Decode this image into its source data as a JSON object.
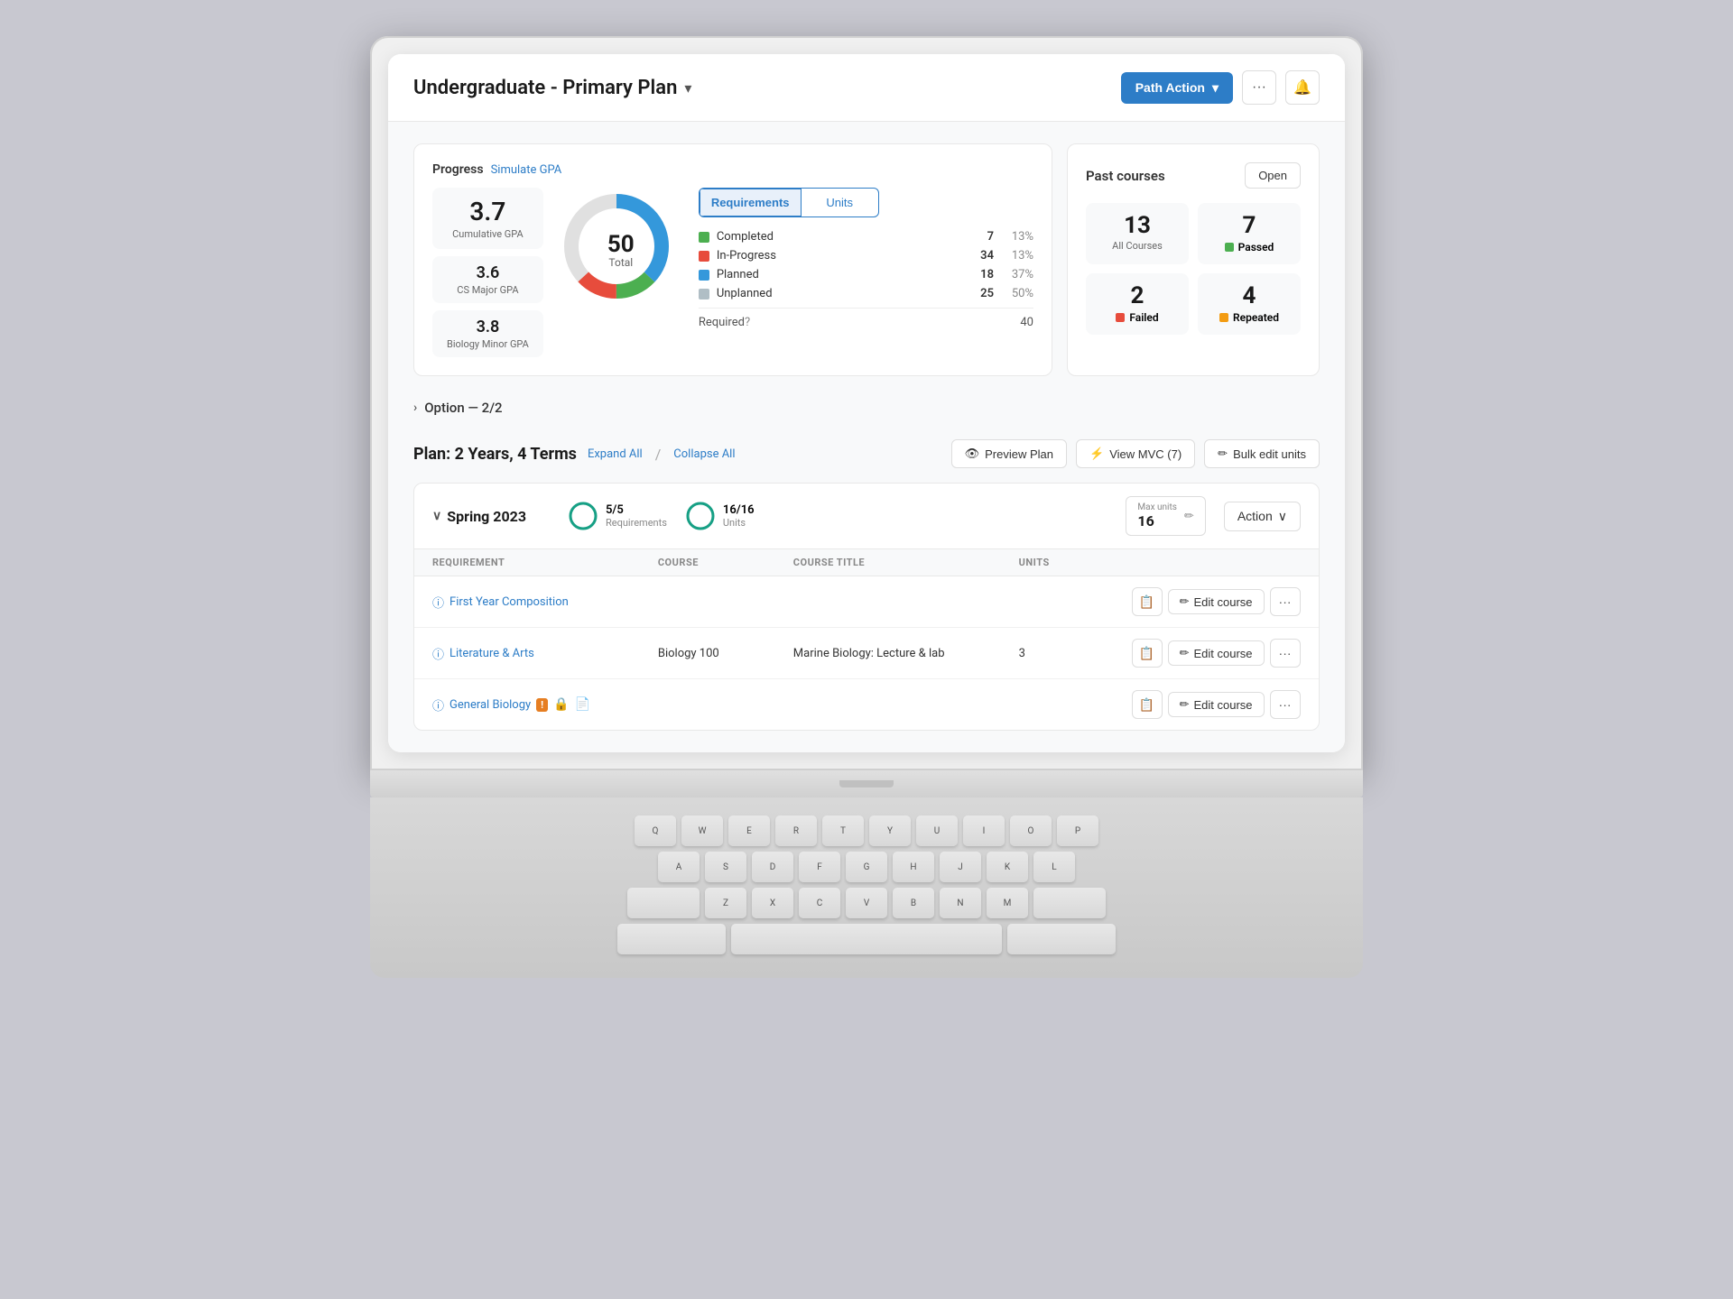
{
  "header": {
    "title": "Undergraduate - Primary Plan",
    "dropdown_icon": "▾",
    "path_action_label": "Path Action",
    "path_action_arrow": "▾",
    "more_icon": "•••",
    "bell_icon": "🔔"
  },
  "progress": {
    "label": "Progress",
    "simulate_gpa": "Simulate GPA",
    "cumulative_gpa": "3.7",
    "cumulative_gpa_label": "Cumulative GPA",
    "cs_major_gpa": "3.6",
    "cs_major_gpa_label": "CS Major GPA",
    "biology_minor_gpa": "3.8",
    "biology_minor_gpa_label": "Biology Minor GPA",
    "donut_total": "50",
    "donut_total_label": "Total",
    "tabs": {
      "requirements": "Requirements",
      "units": "Units"
    },
    "legend": [
      {
        "label": "Completed",
        "count": "7",
        "pct": "13%",
        "color": "#4caf50"
      },
      {
        "label": "In-Progress",
        "count": "34",
        "pct": "13%",
        "color": "#e74c3c"
      },
      {
        "label": "Planned",
        "count": "18",
        "pct": "37%",
        "color": "#3498db"
      },
      {
        "label": "Unplanned",
        "count": "25",
        "pct": "50%",
        "color": "#b0bec5"
      }
    ],
    "required_label": "Required",
    "required_value": "40"
  },
  "past_courses": {
    "title": "Past courses",
    "open_btn": "Open",
    "all_courses_count": "13",
    "all_courses_label": "All Courses",
    "passed_count": "7",
    "passed_label": "Passed",
    "passed_color": "#4caf50",
    "failed_count": "2",
    "failed_label": "Failed",
    "failed_color": "#e74c3c",
    "repeated_count": "4",
    "repeated_label": "Repeated",
    "repeated_color": "#f39c12"
  },
  "option_row": {
    "label": "Option — 2/2"
  },
  "plan": {
    "heading": "Plan: 2 Years, 4 Terms",
    "expand_all": "Expand All",
    "slash": "/",
    "collapse_all": "Collapse All",
    "preview_plan_icon": "👁",
    "preview_plan_label": "Preview Plan",
    "view_mvc_label": "View MVC (7)",
    "bulk_edit_label": "Bulk edit units"
  },
  "term": {
    "chevron": "∨",
    "name": "Spring 2023",
    "req_fraction": "5/5",
    "req_label": "Requirements",
    "units_fraction": "16/16",
    "units_label": "Units",
    "max_units_label": "Max units",
    "max_units_value": "16",
    "action_label": "Action",
    "action_chevron": "∨"
  },
  "table": {
    "columns": [
      "REQUIREMENT",
      "COURSE",
      "COURSE TITLE",
      "UNITS",
      ""
    ],
    "rows": [
      {
        "requirement": "First Year Composition",
        "course": "",
        "title": "",
        "units": "",
        "has_warning": false,
        "has_lock": false,
        "has_doc": false
      },
      {
        "requirement": "Literature & Arts",
        "course": "Biology 100",
        "title": "Marine Biology: Lecture & lab",
        "units": "3",
        "has_warning": false,
        "has_lock": false,
        "has_doc": false
      },
      {
        "requirement": "General Biology",
        "course": "",
        "title": "",
        "units": "",
        "has_warning": true,
        "has_lock": true,
        "has_doc": true
      }
    ]
  },
  "keyboard": {
    "rows": [
      [
        "Q",
        "W",
        "E",
        "R",
        "T",
        "Y",
        "U",
        "I",
        "O",
        "P"
      ],
      [
        "A",
        "S",
        "D",
        "F",
        "G",
        "H",
        "J",
        "K",
        "L"
      ],
      [
        "Z",
        "X",
        "C",
        "V",
        "B",
        "N",
        "M"
      ]
    ]
  }
}
